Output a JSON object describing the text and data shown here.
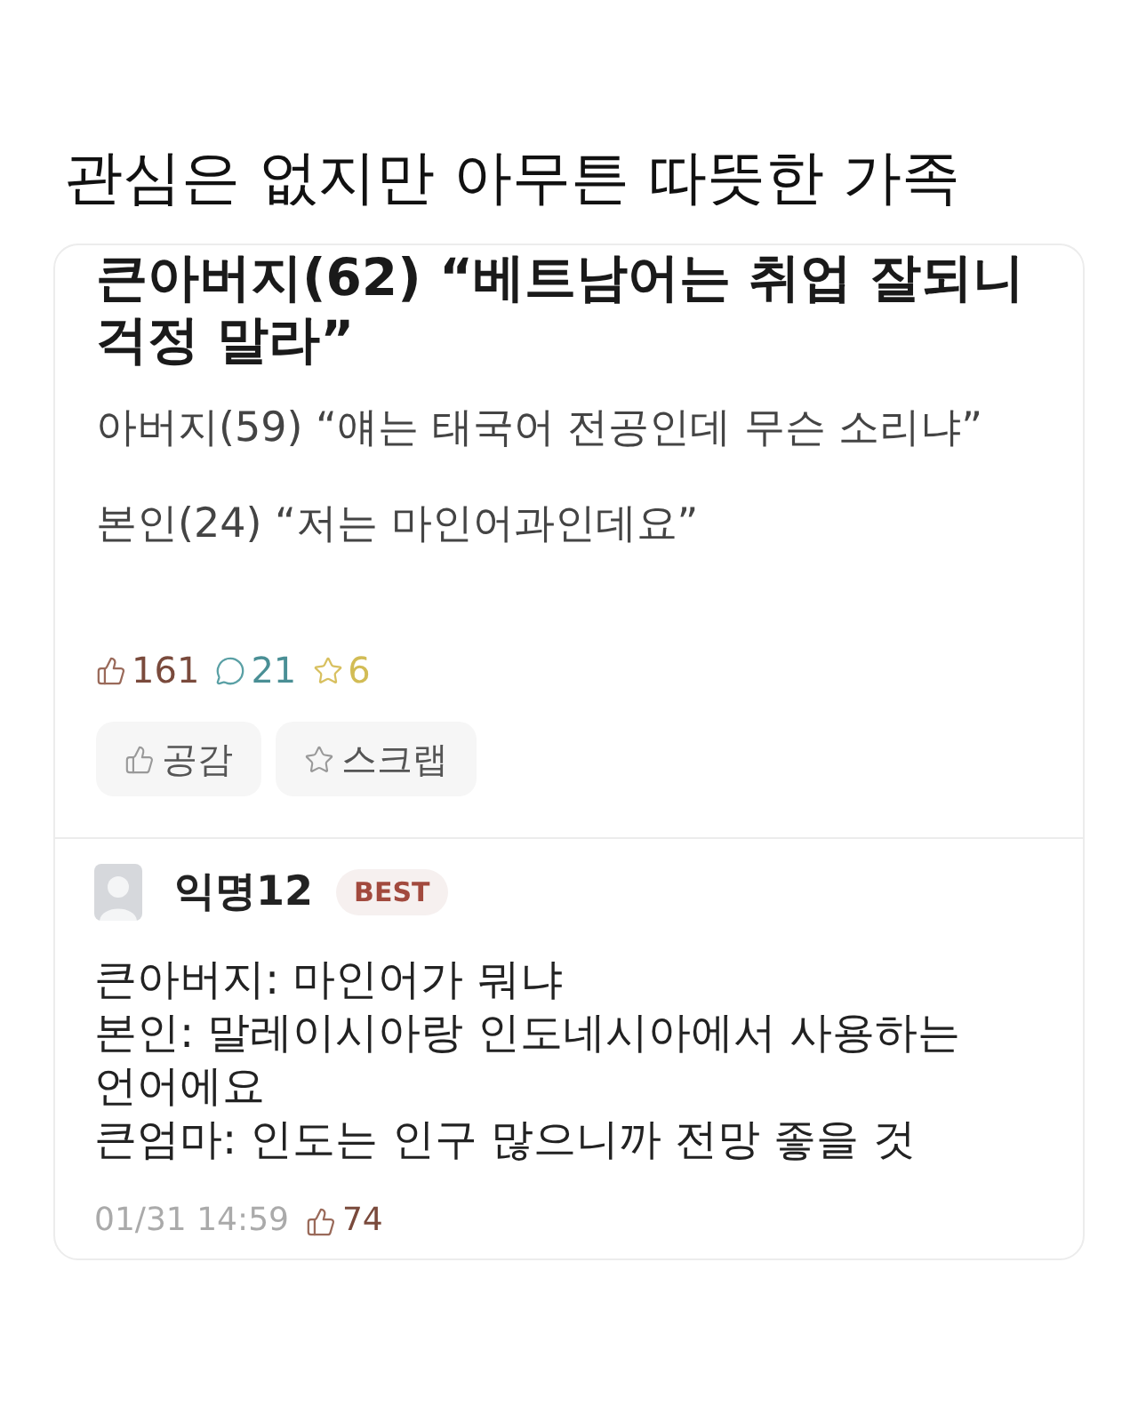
{
  "page_title": "관심은 없지만 아무튼 따뜻한 가족",
  "post": {
    "title": "큰아버지(62) “베트남어는 취업 잘되니 걱정 말라”",
    "paragraphs": [
      "아버지(59) “얘는 태국어 전공인데 무슨 소리냐”",
      "본인(24) “저는 마인어과인데요”"
    ],
    "stats": [
      {
        "kind": "likes",
        "count": "161"
      },
      {
        "kind": "comments",
        "count": "21"
      },
      {
        "kind": "scraps",
        "count": "6"
      }
    ],
    "buttons": [
      {
        "kind": "like",
        "label": "공감"
      },
      {
        "kind": "scrap",
        "label": "스크랩"
      }
    ]
  },
  "comment": {
    "author": "익명12",
    "badge": "BEST",
    "lines": [
      "큰아버지: 마인어가 뭐냐",
      "본인: 말레이시아랑 인도네시아에서 사용하는 언어에요",
      "큰엄마: 인도는 인구 많으니까 전망 좋을 것"
    ],
    "time": "01/31 14:59",
    "likes": "74"
  }
}
